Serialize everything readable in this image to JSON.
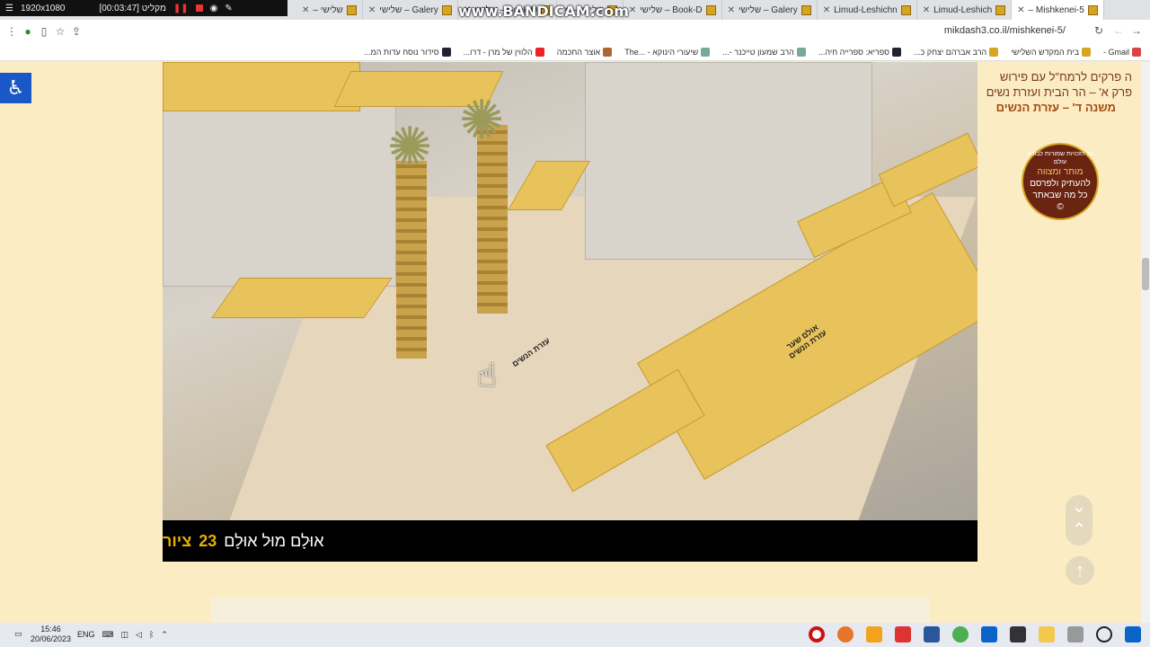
{
  "recorder": {
    "resolution": "1920x1080",
    "status": "[00:03:47] מקליט",
    "watermark": "www.BANDICAM.com"
  },
  "tabs": [
    {
      "label": "שלישי –"
    },
    {
      "label": "Galery – שלישי"
    },
    {
      "label": "Book-D – שלישי"
    },
    {
      "label": "שלישי –"
    },
    {
      "label": "Book-D – שלישי"
    },
    {
      "label": "Galery – שלישי"
    },
    {
      "label": "Limud-Leshichn"
    },
    {
      "label": "Limud-Leshich"
    },
    {
      "label": "Mishkenei-5 –",
      "active": true
    }
  ],
  "address": {
    "url": "mikdash3.co.il/mishkenei-5/"
  },
  "bookmarks": [
    "Gmail -",
    "בית המקדש השלישי",
    "הרב אברהם יצחק כ...",
    "ספריא: ספרייה חיה...",
    "הרב שמעון טייכנר -...",
    "שיעורי הינוקא - ...The",
    "אוצר החכמה",
    "הלווין של מרן - דרו...",
    "סידור נוסח עדות המ..."
  ],
  "figure": {
    "label_court": "עזרת הנשים",
    "label_gate": "אולם שער עזרת הנשים"
  },
  "caption": {
    "prefix": "ציור",
    "number": "23",
    "text": "אוּלָם מוּל אוּלָם"
  },
  "sidebar": {
    "line1": "ה פרקים לרמח\"ל עם פירוש",
    "line2": "פרק א' – הר הבית ועזרת נשים",
    "line3": "משנה ד' – עזרת הנשים"
  },
  "seal": {
    "top": "כל הזכויות שמורות לבורא עולם",
    "line1": "מותר ומצווה",
    "line2": "להעתיק ולפרסם",
    "line3": "כל מה שבאתר",
    "mark": "©"
  },
  "taskbar": {
    "time": "15:46",
    "date": "20/06/2023",
    "lang": "ENG"
  }
}
